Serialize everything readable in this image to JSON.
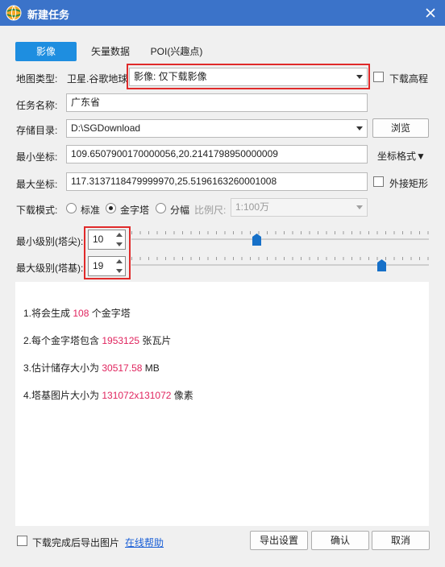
{
  "window": {
    "title": "新建任务",
    "accent": "#3b73c9"
  },
  "tabs": [
    {
      "label": "影像",
      "active": true
    },
    {
      "label": "矢量数据",
      "active": false
    },
    {
      "label": "POI(兴趣点)",
      "active": false
    }
  ],
  "map_type": {
    "label": "地图类型:",
    "source": "卫星.谷歌地球",
    "selected": "影像: 仅下载影像"
  },
  "download_elevation": {
    "label": "下载高程",
    "checked": false
  },
  "task_name": {
    "label": "任务名称:",
    "value": "广东省"
  },
  "storage": {
    "label": "存储目录:",
    "value": "D:\\SGDownload",
    "browse_label": "浏览"
  },
  "min_coord": {
    "label": "最小坐标:",
    "value": "109.6507900170000056,20.2141798950000009"
  },
  "coord_format_label": "坐标格式▼",
  "max_coord": {
    "label": "最大坐标:",
    "value": "117.3137118479999970,25.5196163260001008"
  },
  "bounding_rect": {
    "label": "外接矩形",
    "checked": false
  },
  "download_mode": {
    "label": "下载模式:",
    "options": [
      "标准",
      "金字塔",
      "分幅"
    ],
    "selected": "金字塔",
    "scale_label": "比例尺:",
    "scale_value": "1:100万"
  },
  "min_level": {
    "label": "最小级别(塔尖):",
    "value": "10",
    "slider_fraction": 0.42
  },
  "max_level": {
    "label": "最大级别(塔基):",
    "value": "19",
    "slider_fraction": 0.84
  },
  "info": {
    "line1": {
      "prefix": "1.将会生成",
      "value": "108",
      "suffix": "个金字塔"
    },
    "line2": {
      "prefix": "2.每个金字塔包含",
      "value": "1953125",
      "suffix": "张瓦片"
    },
    "line3": {
      "prefix": "3.估计储存大小为",
      "value": "30517.58",
      "suffix": "MB"
    },
    "line4": {
      "prefix": "4.塔基图片大小为",
      "value": "131072x131072",
      "suffix": "像素"
    }
  },
  "footer": {
    "export_after_label": "下载完成后导出图片",
    "export_after_checked": false,
    "help_link": "在线帮助",
    "export_settings": "导出设置",
    "confirm": "确认",
    "cancel": "取消"
  }
}
